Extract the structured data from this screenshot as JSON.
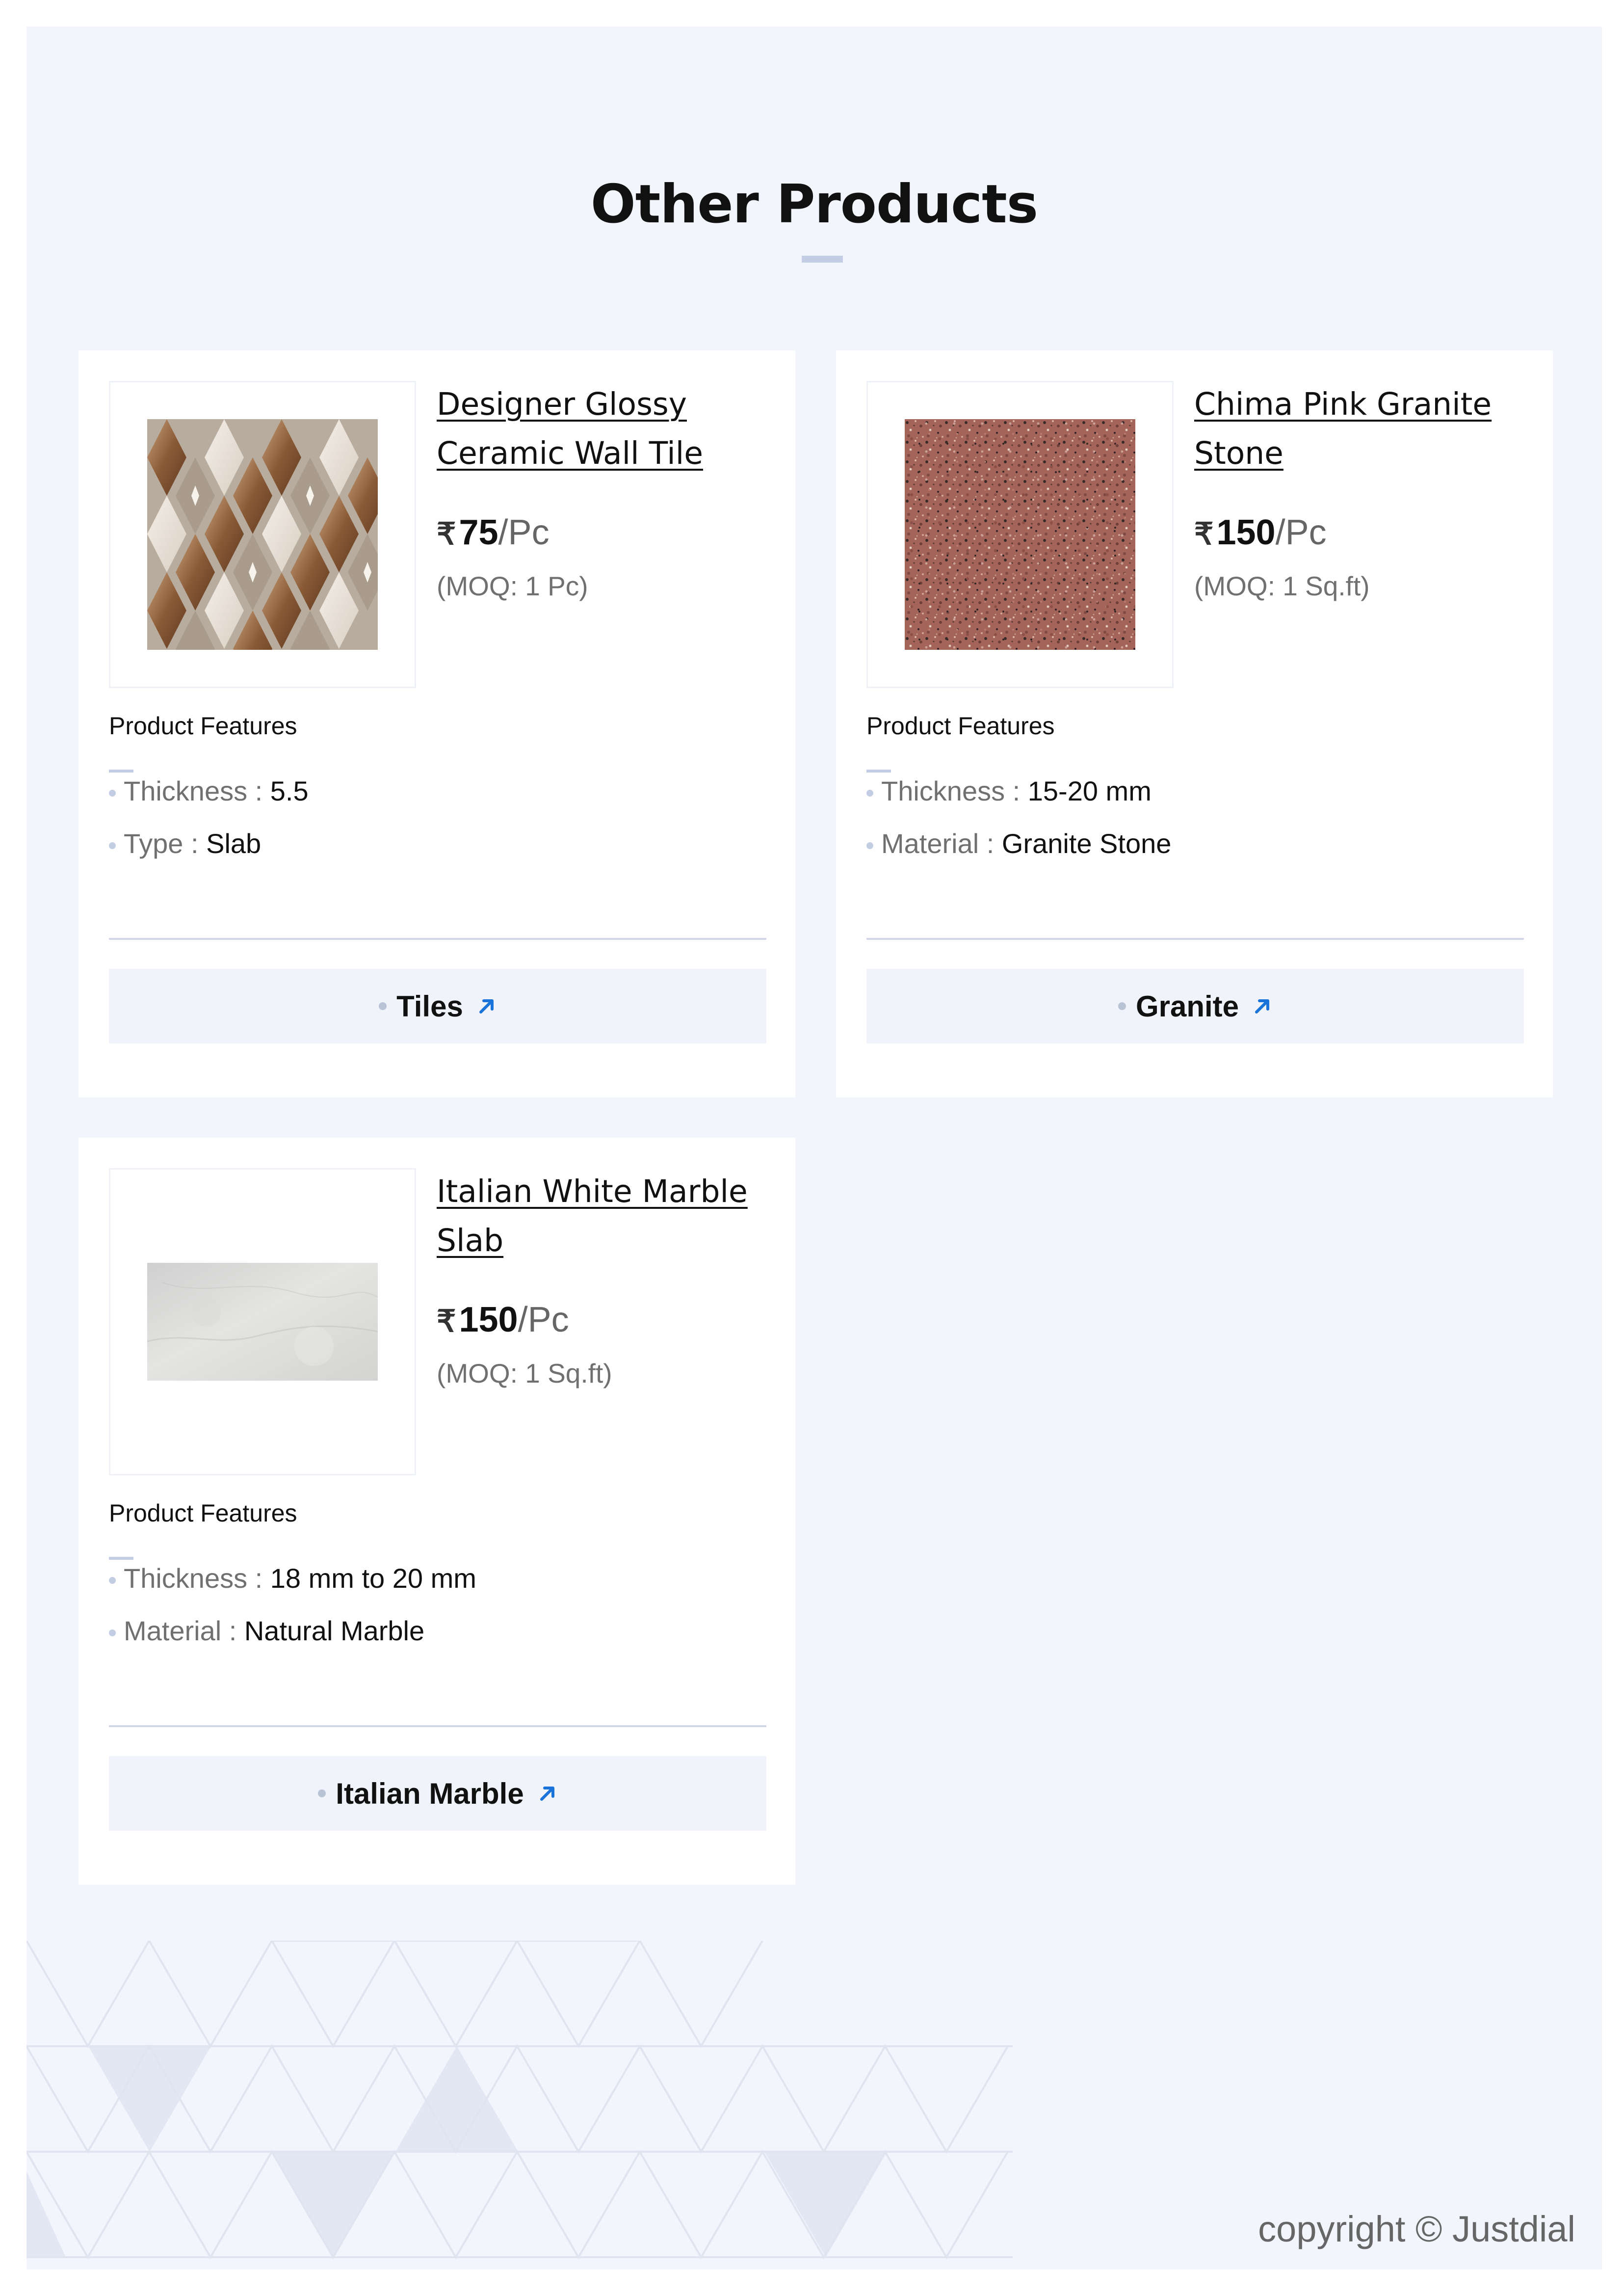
{
  "title": "Other Products",
  "colors": {
    "page_background": "#f2f5fb",
    "accent": "#c3cde3",
    "link_arrow": "#1a73d9"
  },
  "products": [
    {
      "name": "Designer Glossy Ceramic Wall Tile",
      "image": "ceramic-tile-image",
      "currency_symbol": "₹",
      "price": "75",
      "unit": "/Pc",
      "moq": "(MOQ: 1 Pc)",
      "features_heading": "Product Features",
      "features": [
        {
          "label": "Thickness : ",
          "value": "5.5"
        },
        {
          "label": "Type : ",
          "value": "Slab"
        }
      ],
      "category": "Tiles",
      "category_icon": "arrow-up-right-icon"
    },
    {
      "name": "Chima Pink Granite Stone",
      "image": "granite-stone-image",
      "currency_symbol": "₹",
      "price": "150",
      "unit": "/Pc",
      "moq": "(MOQ: 1 Sq.ft)",
      "features_heading": "Product Features",
      "features": [
        {
          "label": "Thickness : ",
          "value": "15-20 mm"
        },
        {
          "label": "Material : ",
          "value": "Granite Stone"
        }
      ],
      "category": "Granite",
      "category_icon": "arrow-up-right-icon"
    },
    {
      "name": "Italian White Marble Slab",
      "image": "marble-slab-image",
      "currency_symbol": "₹",
      "price": "150",
      "unit": "/Pc",
      "moq": "(MOQ: 1 Sq.ft)",
      "features_heading": "Product Features",
      "features": [
        {
          "label": "Thickness : ",
          "value": "18 mm to 20 mm"
        },
        {
          "label": "Material : ",
          "value": "Natural Marble"
        }
      ],
      "category": "Italian Marble",
      "category_icon": "arrow-up-right-icon"
    }
  ],
  "footer": {
    "copyright": "copyright © Justdial"
  }
}
